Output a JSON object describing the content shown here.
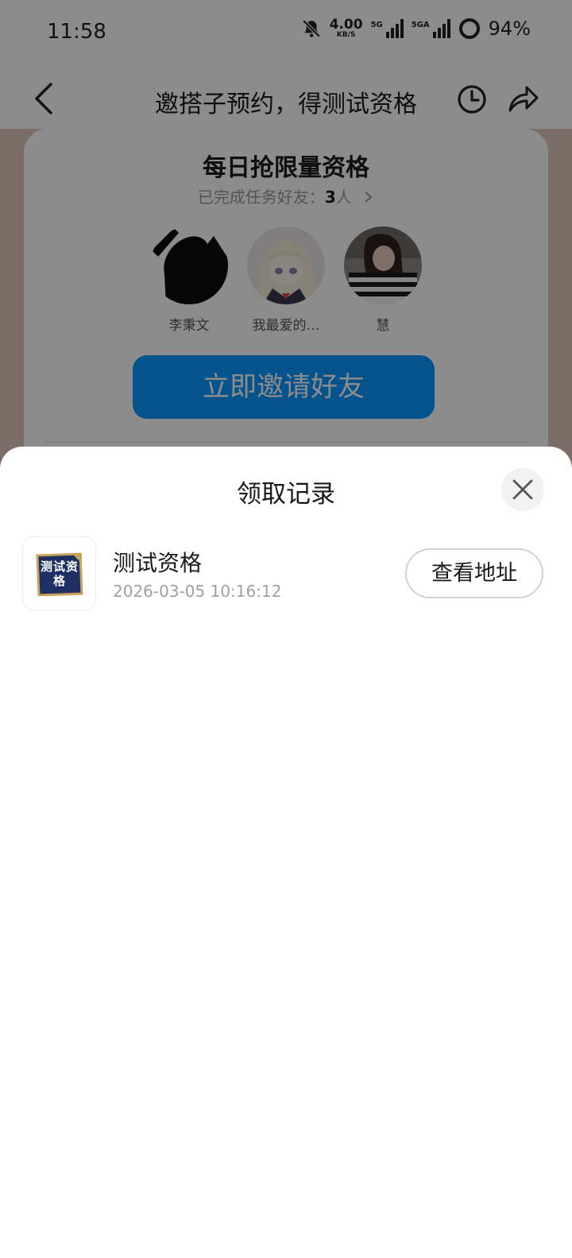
{
  "status_bar": {
    "time": "11:58",
    "net_speed": "4.00",
    "net_speed_unit": "KB/S",
    "sim1_tag": "5G",
    "sim2_tag": "5GA",
    "battery": "94%"
  },
  "nav": {
    "title": "邀搭子预约，得测试资格",
    "icons": [
      "back-arrow-icon",
      "history-clock-icon",
      "share-icon"
    ]
  },
  "invite_card": {
    "title": "每日抢限量资格",
    "completed_prefix": "已完成任务好友：",
    "completed_count": "3",
    "completed_suffix": "人",
    "friends": [
      {
        "name": "李秉文"
      },
      {
        "name": "我最爱的…"
      },
      {
        "name": "慧"
      }
    ],
    "invite_button": "立即邀请好友"
  },
  "sheet": {
    "title": "领取记录",
    "records": [
      {
        "thumb_text": "测试资格",
        "name": "测试资格",
        "time": "2026-03-05 10:16:12",
        "action": "查看地址"
      }
    ]
  },
  "colors": {
    "accent_blue": "#0a97ff",
    "promo_background": "#e2c7bb",
    "overlay": "rgba(0,0,0,0.45)"
  }
}
